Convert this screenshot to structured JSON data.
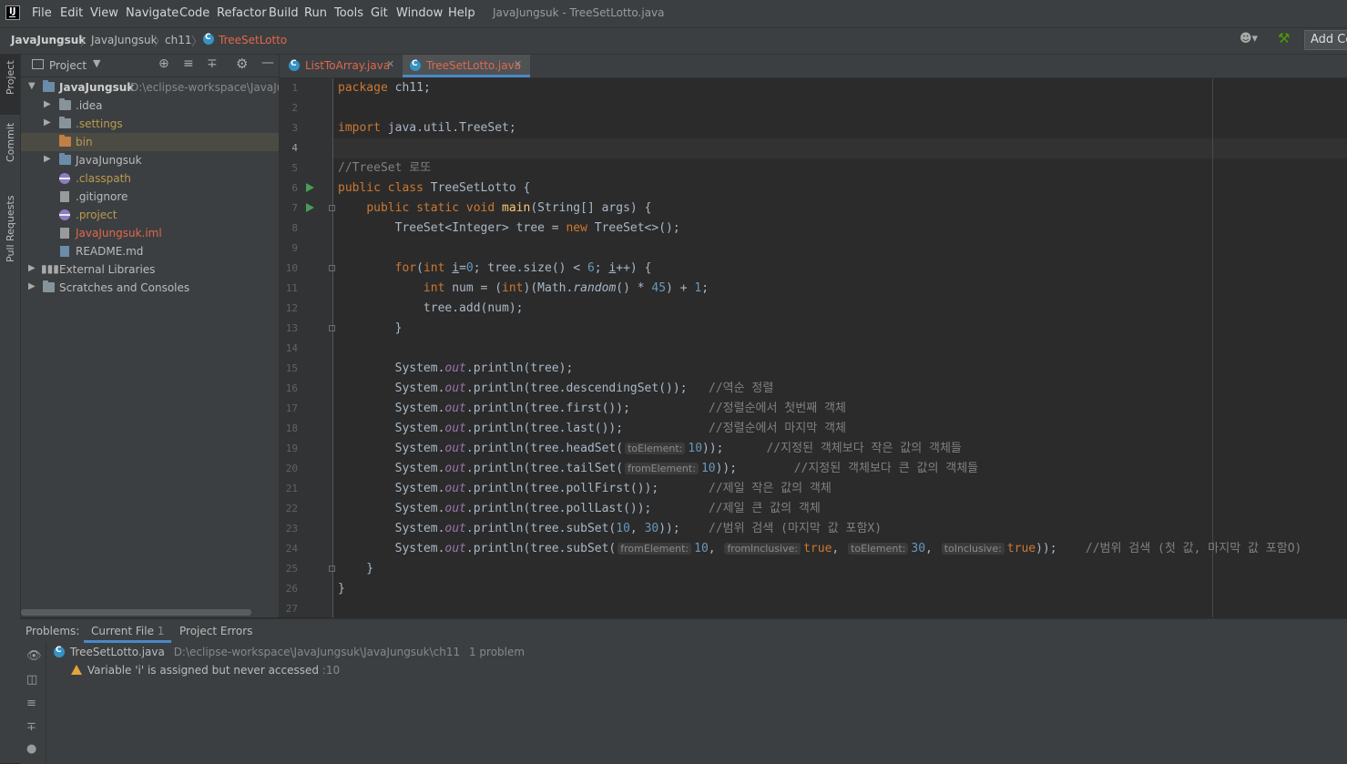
{
  "menu": {
    "items": [
      "File",
      "Edit",
      "View",
      "Navigate",
      "Code",
      "Refactor",
      "Build",
      "Run",
      "Tools",
      "Git",
      "Window",
      "Help"
    ],
    "window_title": "JavaJungsuk - TreeSetLotto.java"
  },
  "breadcrumb": {
    "project": "JavaJungsuk",
    "module": "JavaJungsuk",
    "package": "ch11",
    "file": "TreeSetLotto",
    "add_config": "Add Co"
  },
  "side_tabs": [
    "Project",
    "Commit",
    "Pull Requests"
  ],
  "project_panel": {
    "title": "Project",
    "root": {
      "name": "JavaJungsuk",
      "path": "D:\\eclipse-workspace\\JavaJungsuk"
    },
    "items": [
      {
        "label": ".idea"
      },
      {
        "label": ".settings"
      },
      {
        "label": "bin"
      },
      {
        "label": "JavaJungsuk"
      },
      {
        "label": ".classpath"
      },
      {
        "label": ".gitignore"
      },
      {
        "label": ".project"
      },
      {
        "label": "JavaJungsuk.iml"
      },
      {
        "label": "README.md"
      },
      {
        "label": "External Libraries"
      },
      {
        "label": "Scratches and Consoles"
      }
    ]
  },
  "editor_tabs": [
    {
      "label": "ListToArray.java"
    },
    {
      "label": "TreeSetLotto.java"
    }
  ],
  "hints": {
    "to_element": "toElement:",
    "from_element": "fromElement:",
    "from_inclusive": "fromInclusive:",
    "to_inclusive": "toInclusive:"
  },
  "code": {
    "line_numbers": [
      "1",
      "2",
      "3",
      "4",
      "5",
      "6",
      "7",
      "8",
      "9",
      "10",
      "11",
      "12",
      "13",
      "14",
      "15",
      "16",
      "17",
      "18",
      "19",
      "20",
      "21",
      "22",
      "23",
      "24",
      "25",
      "26",
      "27"
    ],
    "package_name": "ch11",
    "import_path": "java.util.TreeSet",
    "comment_title": "//TreeSet 로또",
    "class_name": "TreeSetLotto",
    "c16": "//역순 정렬",
    "c17": "//정렬순에서 첫번째 객체",
    "c18": "//정렬순에서 마지막 객체",
    "c19": "//지정된 객체보다 작은 값의 객체들",
    "c20": "//지정된 객체보다 큰 값의 객체들",
    "c21": "//제일 작은 값의 객체",
    "c22": "//제일 큰 값의 객체",
    "c23": "//범위 검색 (마지막 값 포함X)",
    "c24": "//범위 검색 (첫 값, 마지막 값 포함O)"
  },
  "problems": {
    "label": "Problems:",
    "tabs": [
      {
        "label": "Current File",
        "count": "1"
      },
      {
        "label": "Project Errors",
        "count": ""
      }
    ],
    "file": "TreeSetLotto.java",
    "path": "D:\\eclipse-workspace\\JavaJungsuk\\JavaJungsuk\\ch11",
    "summary": "1 problem",
    "warning": "Variable 'i' is assigned but never accessed",
    "warning_loc": ":10"
  },
  "colors": {
    "accent": "#4a88c7",
    "keyword": "#cc7832",
    "number": "#6897bb",
    "comment": "#808080",
    "static_field": "#9876aa",
    "method_decl": "#ffc66d",
    "run_marker": "#499c54",
    "warning": "#e2a53b",
    "modified_file": "#e0674d"
  }
}
